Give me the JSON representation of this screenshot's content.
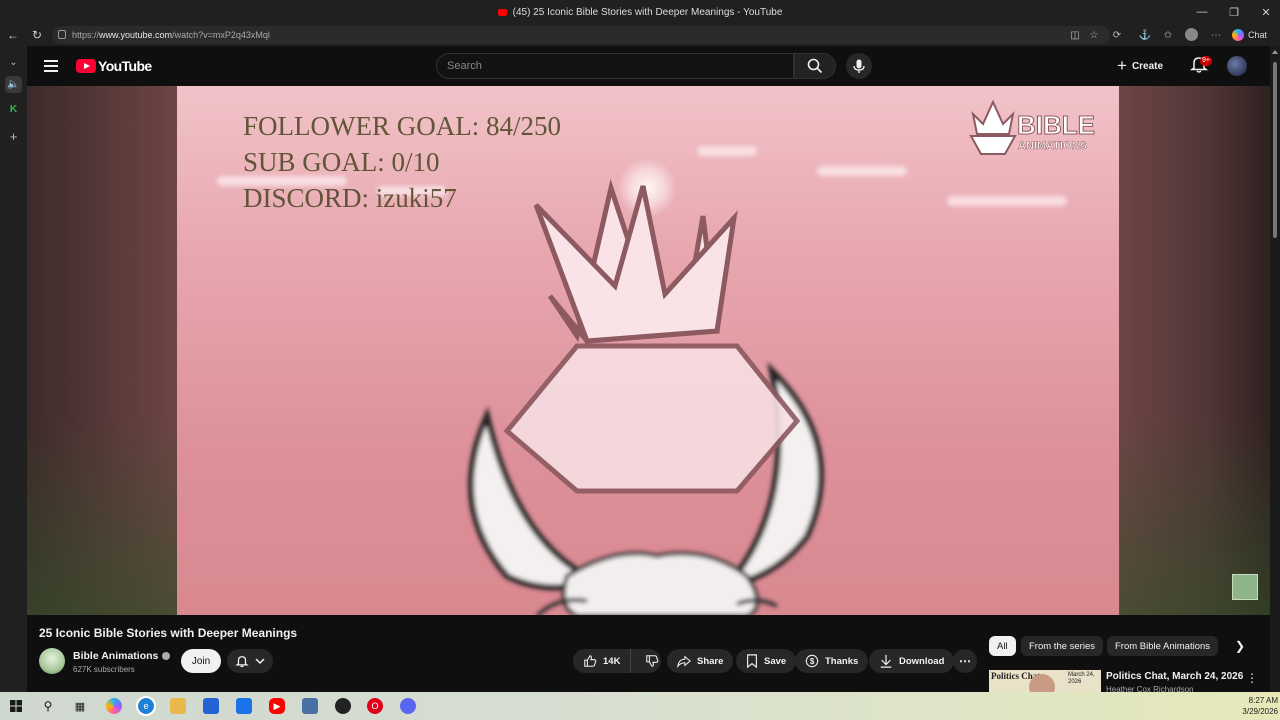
{
  "browser": {
    "window_title": "(45) 25 Iconic Bible Stories with Deeper Meanings - YouTube",
    "url_prefix": "https://",
    "url_host": "www.youtube.com",
    "url_path": "/watch?v=mxP2q43xMql",
    "chat_label": "Chat"
  },
  "masthead": {
    "logo_text": "YouTube",
    "search_placeholder": "Search",
    "create_label": "Create",
    "notif_badge": "9+"
  },
  "video": {
    "overlay_lines": [
      "FOLLOWER GOAL:  84/250",
      "SUB GOAL: 0/10",
      "DISCORD: izuki57"
    ],
    "watermark_line1": "BIBLE",
    "watermark_line2": "ANIMATIONS",
    "title": "25 Iconic Bible Stories with Deeper Meanings"
  },
  "channel": {
    "name": "Bible Animations",
    "subscribers": "627K subscribers",
    "join_label": "Join"
  },
  "actions": {
    "likes": "14K",
    "share": "Share",
    "save": "Save",
    "thanks": "Thanks",
    "download": "Download"
  },
  "chips": [
    "All",
    "From the series",
    "From Bible Animations"
  ],
  "recommendation": {
    "thumb_title": "Politics Chat",
    "thumb_date": "March 24, 2026",
    "title": "Politics Chat, March 24, 2026",
    "channel": "Heather Cox Richardson"
  },
  "taskbar": {
    "time": "8:27 AM",
    "date": "3/29/2026"
  },
  "colors": {
    "youtube_red": "#ff0033",
    "background": "#0f0f0f",
    "chip_bg": "#272727",
    "video_sky": "#e8a8b0"
  },
  "icons": [
    "back-arrow-icon",
    "refresh-icon",
    "menu-icon",
    "search-icon",
    "mic-icon",
    "bell-icon",
    "like-icon",
    "dislike-icon",
    "share-icon",
    "save-icon",
    "thanks-icon",
    "download-icon",
    "more-icon",
    "chevron-right-icon"
  ]
}
